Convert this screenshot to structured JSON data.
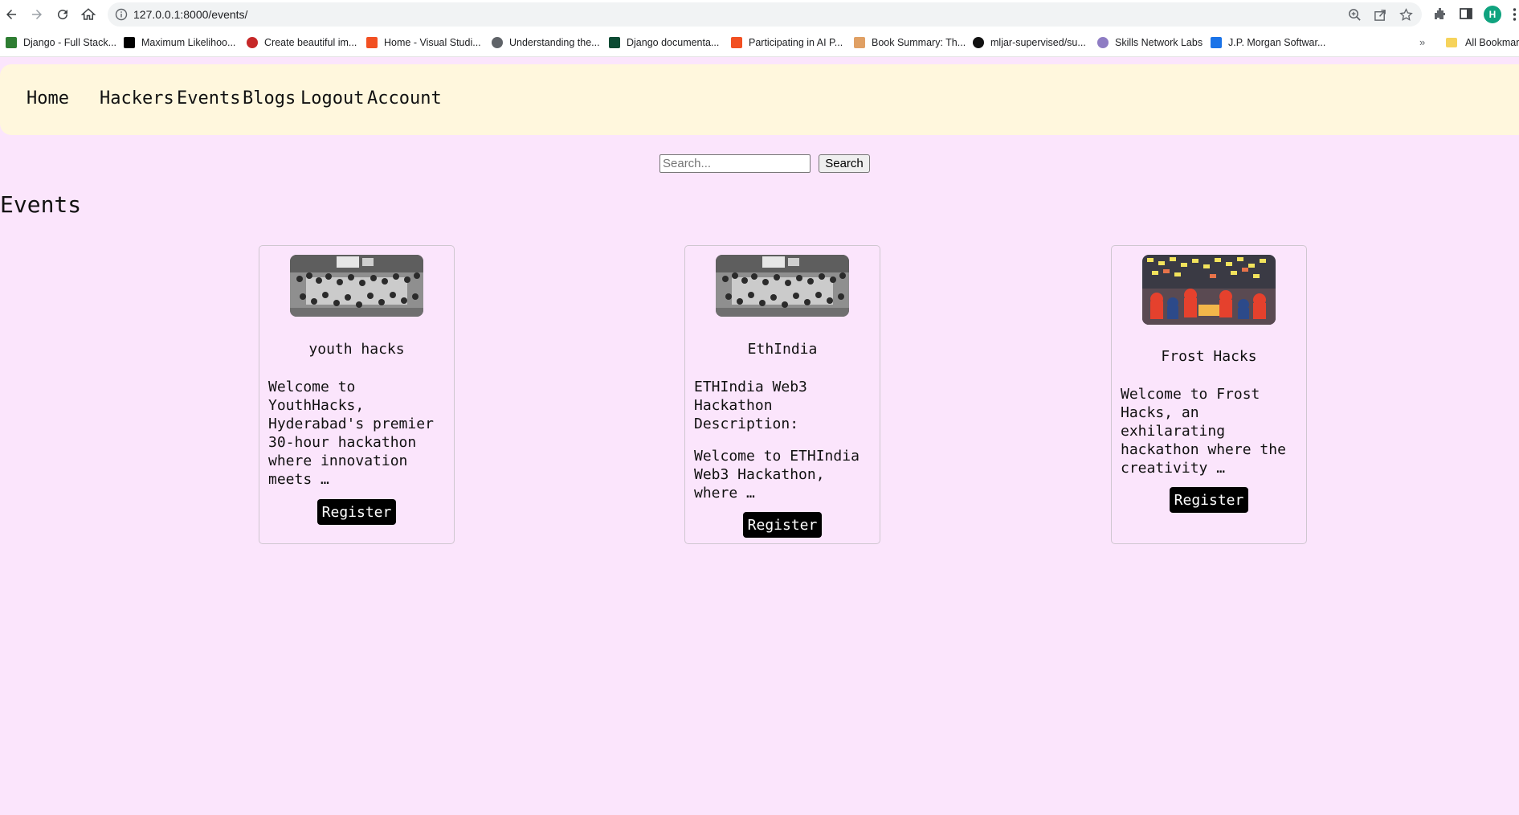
{
  "browser": {
    "url": "127.0.0.1:8000/events/",
    "profile_initial": "H",
    "bookmarks": [
      {
        "label": "Django - Full Stack...",
        "icon": "sheet-icon",
        "color": "#2e7d32"
      },
      {
        "label": "Maximum Likelihoo...",
        "icon": "medium-icon",
        "color": "#000000"
      },
      {
        "label": "Create beautiful im...",
        "icon": "circle-record-icon",
        "color": "#c62828"
      },
      {
        "label": "Home - Visual Studi...",
        "icon": "microsoft-icon",
        "color": "#f25022"
      },
      {
        "label": "Understanding the...",
        "icon": "globe-icon",
        "color": "#5f6368"
      },
      {
        "label": "Django documenta...",
        "icon": "django-icon",
        "color": "#0c4b33"
      },
      {
        "label": "Participating in AI P...",
        "icon": "microsoft-icon",
        "color": "#f25022"
      },
      {
        "label": "Book Summary: Th...",
        "icon": "person-icon",
        "color": "#e0a064"
      },
      {
        "label": "mljar-supervised/su...",
        "icon": "github-icon",
        "color": "#111111"
      },
      {
        "label": "Skills Network Labs",
        "icon": "network-icon",
        "color": "#8e7cc3"
      },
      {
        "label": "J.P. Morgan Softwar...",
        "icon": "forage-icon",
        "color": "#1a73e8"
      }
    ],
    "bookmarks_more": "»",
    "all_bookmarks": "All Bookmarks"
  },
  "nav": {
    "home": "Home",
    "hackers": "Hackers",
    "events": "Events",
    "blogs": "Blogs",
    "logout": "Logout",
    "account": "Account"
  },
  "search": {
    "placeholder": "Search...",
    "button": "Search"
  },
  "page_title": "Events",
  "events": [
    {
      "title": "youth hacks",
      "description": [
        "Welcome to YouthHacks, Hyderabad's premier 30-hour hackathon where innovation meets …"
      ],
      "button": "Register",
      "image": "hackathon-hall-photo"
    },
    {
      "title": "EthIndia",
      "description": [
        "ETHIndia Web3 Hackathon Description:",
        "Welcome to ETHIndia Web3 Hackathon, where …"
      ],
      "button": "Register",
      "image": "hackathon-hall-photo"
    },
    {
      "title": "Frost Hacks",
      "description": [
        "Welcome to Frost Hacks, an exhilarating hackathon where the creativity …"
      ],
      "button": "Register",
      "image": "sticky-notes-team-photo"
    }
  ]
}
